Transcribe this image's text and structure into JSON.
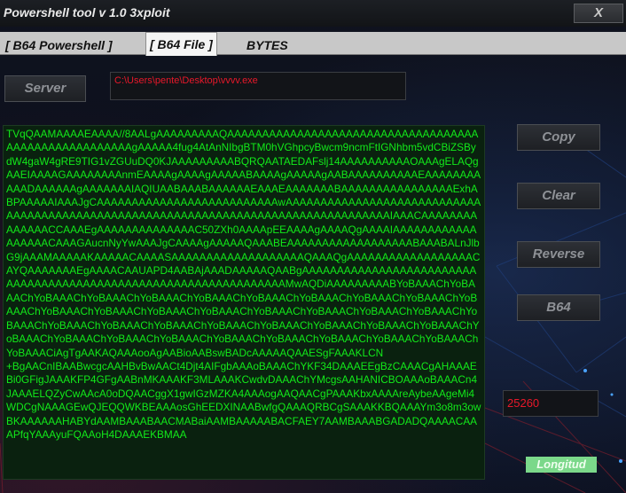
{
  "window": {
    "title": "Powershell tool v 1.0 3xploit",
    "close_label": "X"
  },
  "tabs": [
    {
      "label": "[ B64 Powershell ]"
    },
    {
      "label": "[ B64 File ]"
    },
    {
      "label": "BYTES"
    }
  ],
  "active_tab": 1,
  "server_button": "Server",
  "file_path": "C:\\Users\\pente\\Desktop\\vvvv.exe",
  "base64_output": "TVqQAAMAAAAEAAAA//8AALgAAAAAAAAAQAAAAAAAAAAAAAAAAAAAAAAAAAAAAAAAAAAAAAAAAAAAAAAAAAAAAAAgAAAAA4fug4AtAnNIbgBTM0hVGhpcyBwcm9ncmFtIGNhbm5vdCBiZSBydW4gaW4gRE9TIG1vZGUuDQ0KJAAAAAAAAABQRQAATAEDAFslj14AAAAAAAAAAOAAAgELAQgAAEIAAAAGAAAAAAAAnmEAAAAgAAAAgAAAAABAAAAgAAAAAgAABAAAAAAAAAAEAAAAAAAAAAADAAAAAAgAAAAAAAIAQIUAABAAABAAAAAAEAAAEAAAAAAABAAAAAAAAAAAAAAAAExhABPAAAAAIAAAJgCAAAAAAAAAAAAAAAAAAAAAAAAAAwAAAAAAAAAAAAAAAAAAAAAAAAAAAAAAAAAAAAAAAAAAAAAAAAAAAAAAAAAAAAAAAAAAAAAAAAAAAAAAAAAAAIAAACAAAAAAAAAAAAAACCAAAEgAAAAAAAAAAAAAAC50ZXh0AAAApEEAAAAgAAAAQgAAAAIAAAAAAAAAAAAAAAAAACAAAGAucnNyYwAAAJgCAAAAgAAAAAQAAABEAAAAAAAAAAAAAAAAAABAAABALnJlbG9jAAAMAAAAAKAAAAACAAAASAAAAAAAAAAAAAAAAAAAQAAAQgAAAAAAAAAAAAAAAAAACAYQAAAAAAAEgAAAACAAUAPD4AABAjAAADAAAAAQAABgAAAAAAAAAAAAAAAAAAAAAAAAAAAAAAAAAAAAAAAAAAAAAAAAAAAAAAAAAAAAAAAAAMwAQDiAAAAAAAAABYoBAAAChYoBAAAChYoBAAAChYoBAAAChYoBAAAChYoBAAAChYoBAAAChYoBAAAChYoBAAAChYoBAAAChYoBAAAChYoBAAAChYoBAAAChYoBAAAChYoBAAAChYoBAAAChYoBAAAChYoBAAAChYoBAAAChYoBAAAChYoBAAAChYoBAAAChYoBAAAChYoBAAAChYoBAAAChYoBAAAChYoBAAAChYoBAAAChYoBAAAChYoBAAAChYoBAAAChYoBAAAChYoBAAAChYoBAAAChYoBAAAChYoBAAAChYoBAAAChYoBAAACiAgTgAAKAQAAAooAgAABioAABswBADcAAAAAQAAESgFAAAKLCN\n+BgAACnIBAABwcgcAAHBvBwAACt4Djt4AIFgbAAAoBAAAChYKF34DAAAEEgBzCAAACgAHAAAEBi0GFigJAAAKFP4GFgAABnMKAAAKF3MLAAAKCwdvDAAAChYMcgsAAHANICBOAAAoBAAACn4JAAAELQZyCwAAcA0oDQAACggX1gwIGzMZKA4AAAogAAQAACgPAAAKbxAAAAreAybeAAgeMi4WDCgNAAAGEwQJEQQWKBEAAAosGhEEDXINAABwfgQAAAQRBCgSAAAKKBQAAAYm3o8m3owBKAAAAAAHABYdAAMBAAABAACMABaiAAMBAAAAABACFAEY7AAMBAAABGADADQAAAACAAAPfqYAAAyuFQAAoH4DAAAEKBMAA",
  "length_value": "25260",
  "length_label": "Longitud",
  "buttons": {
    "copy": "Copy",
    "clear": "Clear",
    "reverse": "Reverse",
    "b64": "B64"
  }
}
